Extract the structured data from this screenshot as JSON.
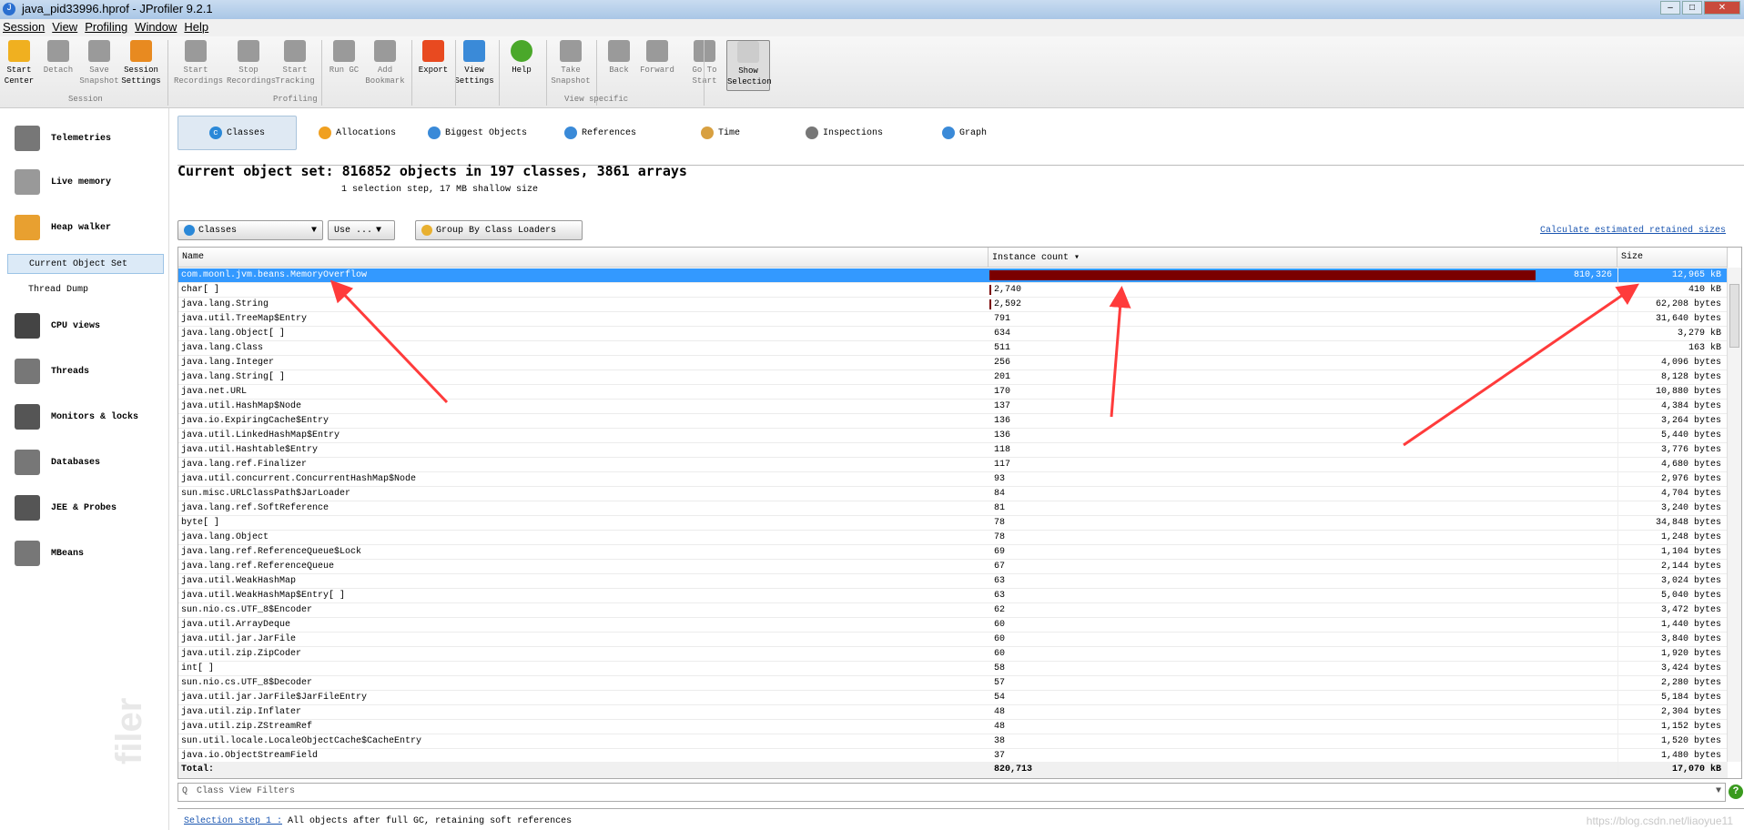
{
  "window": {
    "title": "java_pid33996.hprof - JProfiler 9.2.1"
  },
  "menu": [
    "Session",
    "View",
    "Profiling",
    "Window",
    "Help"
  ],
  "toolbar": {
    "buttons": [
      {
        "label": "Start Center",
        "icon": "start-center-icon",
        "enabled": true
      },
      {
        "label": "Detach",
        "icon": "detach-icon",
        "enabled": false
      },
      {
        "label": "Save Snapshot",
        "icon": "save-icon",
        "enabled": false
      },
      {
        "label": "Session Settings",
        "icon": "session-settings-icon",
        "enabled": true
      },
      {
        "label": "Start Recordings",
        "icon": "start-recordings-icon",
        "enabled": false
      },
      {
        "label": "Stop Recordings",
        "icon": "stop-recordings-icon",
        "enabled": false
      },
      {
        "label": "Start Tracking",
        "icon": "start-tracking-icon",
        "enabled": false
      },
      {
        "label": "Run GC",
        "icon": "run-gc-icon",
        "enabled": false
      },
      {
        "label": "Add Bookmark",
        "icon": "bookmark-icon",
        "enabled": false
      },
      {
        "label": "Export",
        "icon": "export-icon",
        "enabled": true
      },
      {
        "label": "View Settings",
        "icon": "view-settings-icon",
        "enabled": true
      },
      {
        "label": "Help",
        "icon": "help-icon",
        "enabled": true
      },
      {
        "label": "Take Snapshot",
        "icon": "camera-icon",
        "enabled": false
      },
      {
        "label": "Back",
        "icon": "back-icon",
        "enabled": false
      },
      {
        "label": "Forward",
        "icon": "forward-icon",
        "enabled": false
      },
      {
        "label": "Go To Start",
        "icon": "home-icon",
        "enabled": false
      },
      {
        "label": "Show Selection",
        "icon": "show-selection-icon",
        "enabled": true
      }
    ],
    "groups": [
      "Session",
      "Profiling",
      "View specific"
    ]
  },
  "sidebar": {
    "items": [
      "Telemetries",
      "Live memory",
      "Heap walker",
      "CPU views",
      "Threads",
      "Monitors & locks",
      "Databases",
      "JEE & Probes",
      "MBeans"
    ],
    "subitems": [
      "Current Object Set",
      "Thread Dump"
    ],
    "selected": "Current Object Set",
    "watermark": "filer"
  },
  "tabs": [
    "Classes",
    "Allocations",
    "Biggest Objects",
    "References",
    "Time",
    "Inspections",
    "Graph"
  ],
  "heading": "Current object set: 816852 objects in 197 classes, 3861 arrays",
  "subheading": "1 selection step, 17 MB shallow size",
  "controls": {
    "view_select": "Classes",
    "use_button": "Use ...",
    "group_button": "Group By Class Loaders",
    "calc_link": "Calculate estimated retained sizes"
  },
  "table": {
    "columns": [
      "Name",
      "Instance count ▾",
      "Size"
    ],
    "rows": [
      [
        "com.moonl.jvm.beans.MemoryOverflow",
        810326,
        "810,326",
        "12,965 kB"
      ],
      [
        "char[ ]",
        2740,
        "2,740",
        "410 kB"
      ],
      [
        "java.lang.String",
        2592,
        "2,592",
        "62,208 bytes"
      ],
      [
        "java.util.TreeMap$Entry",
        791,
        "791",
        "31,640 bytes"
      ],
      [
        "java.lang.Object[ ]",
        634,
        "634",
        "3,279 kB"
      ],
      [
        "java.lang.Class",
        511,
        "511",
        "163 kB"
      ],
      [
        "java.lang.Integer",
        256,
        "256",
        "4,096 bytes"
      ],
      [
        "java.lang.String[ ]",
        201,
        "201",
        "8,128 bytes"
      ],
      [
        "java.net.URL",
        170,
        "170",
        "10,880 bytes"
      ],
      [
        "java.util.HashMap$Node",
        137,
        "137",
        "4,384 bytes"
      ],
      [
        "java.io.ExpiringCache$Entry",
        136,
        "136",
        "3,264 bytes"
      ],
      [
        "java.util.LinkedHashMap$Entry",
        136,
        "136",
        "5,440 bytes"
      ],
      [
        "java.util.Hashtable$Entry",
        118,
        "118",
        "3,776 bytes"
      ],
      [
        "java.lang.ref.Finalizer",
        117,
        "117",
        "4,680 bytes"
      ],
      [
        "java.util.concurrent.ConcurrentHashMap$Node",
        93,
        "93",
        "2,976 bytes"
      ],
      [
        "sun.misc.URLClassPath$JarLoader",
        84,
        "84",
        "4,704 bytes"
      ],
      [
        "java.lang.ref.SoftReference",
        81,
        "81",
        "3,240 bytes"
      ],
      [
        "byte[ ]",
        78,
        "78",
        "34,848 bytes"
      ],
      [
        "java.lang.Object",
        78,
        "78",
        "1,248 bytes"
      ],
      [
        "java.lang.ref.ReferenceQueue$Lock",
        69,
        "69",
        "1,104 bytes"
      ],
      [
        "java.lang.ref.ReferenceQueue",
        67,
        "67",
        "2,144 bytes"
      ],
      [
        "java.util.WeakHashMap",
        63,
        "63",
        "3,024 bytes"
      ],
      [
        "java.util.WeakHashMap$Entry[ ]",
        63,
        "63",
        "5,040 bytes"
      ],
      [
        "sun.nio.cs.UTF_8$Encoder",
        62,
        "62",
        "3,472 bytes"
      ],
      [
        "java.util.ArrayDeque",
        60,
        "60",
        "1,440 bytes"
      ],
      [
        "java.util.jar.JarFile",
        60,
        "60",
        "3,840 bytes"
      ],
      [
        "java.util.zip.ZipCoder",
        60,
        "60",
        "1,920 bytes"
      ],
      [
        "int[ ]",
        58,
        "58",
        "3,424 bytes"
      ],
      [
        "sun.nio.cs.UTF_8$Decoder",
        57,
        "57",
        "2,280 bytes"
      ],
      [
        "java.util.jar.JarFile$JarFileEntry",
        54,
        "54",
        "5,184 bytes"
      ],
      [
        "java.util.zip.Inflater",
        48,
        "48",
        "2,304 bytes"
      ],
      [
        "java.util.zip.ZStreamRef",
        48,
        "48",
        "1,152 bytes"
      ],
      [
        "sun.util.locale.LocaleObjectCache$CacheEntry",
        38,
        "38",
        "1,520 bytes"
      ],
      [
        "java.io.ObjectStreamField",
        37,
        "37",
        "1,480 bytes"
      ]
    ],
    "total": {
      "label": "Total:",
      "count": "820,713",
      "size": "17,070 kB"
    },
    "bar_color": "#7a0000",
    "selection_color": "#3399ff"
  },
  "filter": {
    "placeholder": "Class View Filters"
  },
  "selection_step": {
    "link": "Selection step 1 :",
    "text": " All objects after full GC, retaining soft references"
  },
  "watermark_url": "https://blog.csdn.net/liaoyue11",
  "annotation_color": "#ff3b3b"
}
